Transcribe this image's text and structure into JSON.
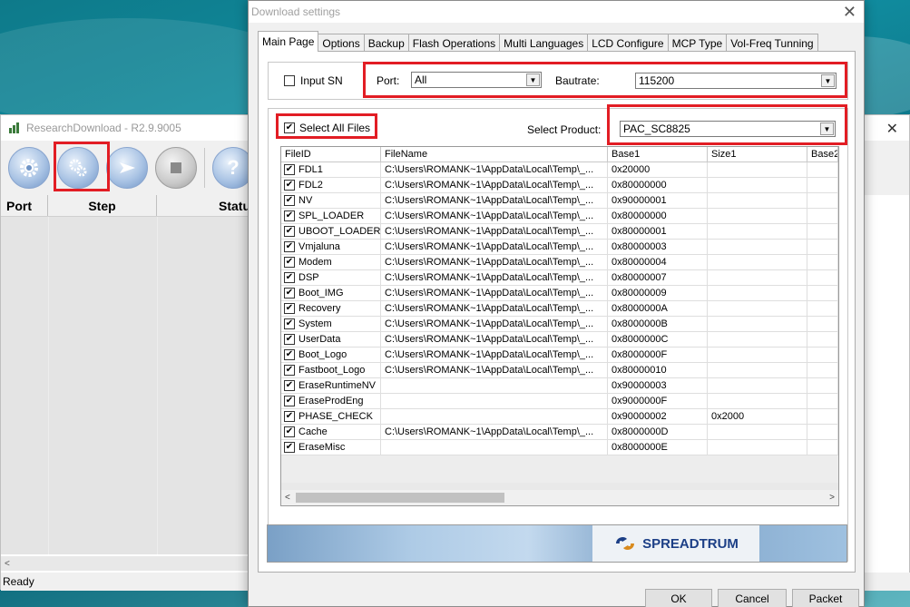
{
  "bg_app": {
    "title": "ResearchDownload - R2.9.9005",
    "close": "✕",
    "toolbar_buttons": [
      {
        "name": "load-packet-button",
        "icon": "gear-icon"
      },
      {
        "name": "settings-button",
        "icon": "gears-icon"
      },
      {
        "name": "start-button",
        "icon": "play-icon"
      },
      {
        "name": "stop-button",
        "icon": "stop-icon"
      },
      {
        "name": "help-button",
        "icon": "help-icon",
        "label": "?"
      }
    ],
    "columns": [
      "Port",
      "Step",
      "Statu"
    ],
    "status": "Ready",
    "scroll_left": "<"
  },
  "dialog": {
    "title": "Download settings",
    "close": "✕",
    "tabs": [
      "Main Page",
      "Options",
      "Backup",
      "Flash Operations",
      "Multi Languages",
      "LCD Configure",
      "MCP Type",
      "Vol-Freq Tunning"
    ],
    "active_tab": "Main Page",
    "input_sn_label": "Input SN",
    "input_sn_checked": false,
    "port_label": "Port:",
    "port_value": "All",
    "baudrate_label": "Bautrate:",
    "baudrate_value": "115200",
    "select_all_label": "Select All Files",
    "select_all_checked": true,
    "select_product_label": "Select Product:",
    "product_value": "PAC_SC8825",
    "file_columns": [
      "FileID",
      "FileName",
      "Base1",
      "Size1",
      "Base2"
    ],
    "files": [
      {
        "id": "FDL1",
        "name": "C:\\Users\\ROMANK~1\\AppData\\Local\\Temp\\_...",
        "base": "0x20000",
        "size": ""
      },
      {
        "id": "FDL2",
        "name": "C:\\Users\\ROMANK~1\\AppData\\Local\\Temp\\_...",
        "base": "0x80000000",
        "size": ""
      },
      {
        "id": "NV",
        "name": "C:\\Users\\ROMANK~1\\AppData\\Local\\Temp\\_...",
        "base": "0x90000001",
        "size": ""
      },
      {
        "id": "SPL_LOADER",
        "name": "C:\\Users\\ROMANK~1\\AppData\\Local\\Temp\\_...",
        "base": "0x80000000",
        "size": ""
      },
      {
        "id": "UBOOT_LOADER",
        "name": "C:\\Users\\ROMANK~1\\AppData\\Local\\Temp\\_...",
        "base": "0x80000001",
        "size": ""
      },
      {
        "id": "Vmjaluna",
        "name": "C:\\Users\\ROMANK~1\\AppData\\Local\\Temp\\_...",
        "base": "0x80000003",
        "size": ""
      },
      {
        "id": "Modem",
        "name": "C:\\Users\\ROMANK~1\\AppData\\Local\\Temp\\_...",
        "base": "0x80000004",
        "size": ""
      },
      {
        "id": "DSP",
        "name": "C:\\Users\\ROMANK~1\\AppData\\Local\\Temp\\_...",
        "base": "0x80000007",
        "size": ""
      },
      {
        "id": "Boot_IMG",
        "name": "C:\\Users\\ROMANK~1\\AppData\\Local\\Temp\\_...",
        "base": "0x80000009",
        "size": ""
      },
      {
        "id": "Recovery",
        "name": "C:\\Users\\ROMANK~1\\AppData\\Local\\Temp\\_...",
        "base": "0x8000000A",
        "size": ""
      },
      {
        "id": "System",
        "name": "C:\\Users\\ROMANK~1\\AppData\\Local\\Temp\\_...",
        "base": "0x8000000B",
        "size": ""
      },
      {
        "id": "UserData",
        "name": "C:\\Users\\ROMANK~1\\AppData\\Local\\Temp\\_...",
        "base": "0x8000000C",
        "size": ""
      },
      {
        "id": "Boot_Logo",
        "name": "C:\\Users\\ROMANK~1\\AppData\\Local\\Temp\\_...",
        "base": "0x8000000F",
        "size": ""
      },
      {
        "id": "Fastboot_Logo",
        "name": "C:\\Users\\ROMANK~1\\AppData\\Local\\Temp\\_...",
        "base": "0x80000010",
        "size": ""
      },
      {
        "id": "EraseRuntimeNV",
        "name": "",
        "base": "0x90000003",
        "size": ""
      },
      {
        "id": "EraseProdEng",
        "name": "",
        "base": "0x9000000F",
        "size": ""
      },
      {
        "id": "PHASE_CHECK",
        "name": "",
        "base": "0x90000002",
        "size": "0x2000"
      },
      {
        "id": "Cache",
        "name": "C:\\Users\\ROMANK~1\\AppData\\Local\\Temp\\_...",
        "base": "0x8000000D",
        "size": ""
      },
      {
        "id": "EraseMisc",
        "name": "",
        "base": "0x8000000E",
        "size": ""
      }
    ],
    "scroll_left": "<",
    "scroll_right": ">",
    "brand": "SPREADTRUM",
    "buttons": {
      "ok": "OK",
      "cancel": "Cancel",
      "packet": "Packet"
    },
    "check_mark": "✔",
    "combo_arrow": "▼"
  },
  "colors": {
    "highlight": "#e21d24",
    "brand": "#1c3f86"
  }
}
